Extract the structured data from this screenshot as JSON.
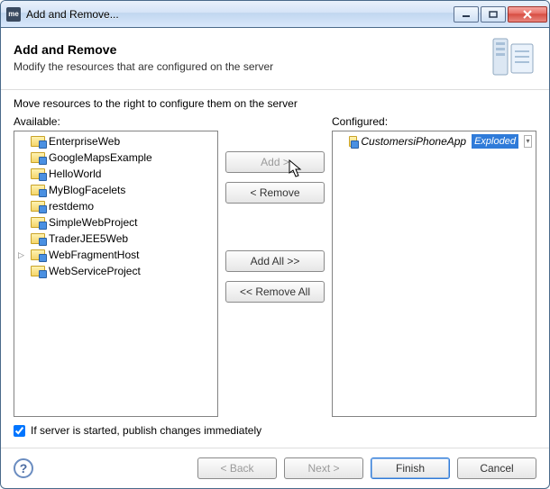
{
  "titlebar": {
    "app_icon_text": "me",
    "title": "Add and Remove..."
  },
  "header": {
    "title": "Add and Remove",
    "desc": "Modify the resources that are configured on the server"
  },
  "body": {
    "instruction": "Move resources to the right to configure them on the server",
    "available_label": "Available:",
    "configured_label": "Configured:",
    "available_items": [
      "EnterpriseWeb",
      "GoogleMapsExample",
      "HelloWorld",
      "MyBlogFacelets",
      "restdemo",
      "SimpleWebProject",
      "TraderJEE5Web",
      "WebFragmentHost",
      "WebServiceProject"
    ],
    "expandable_index": 7,
    "configured_item": {
      "name": "CustomersiPhoneApp",
      "badge": "Exploded"
    },
    "buttons": {
      "add": "Add >",
      "remove": "< Remove",
      "add_all": "Add All >>",
      "remove_all": "<< Remove All"
    },
    "checkbox_label": "If server is started, publish changes immediately",
    "checkbox_checked": true
  },
  "footer": {
    "back": "< Back",
    "next": "Next >",
    "finish": "Finish",
    "cancel": "Cancel"
  }
}
